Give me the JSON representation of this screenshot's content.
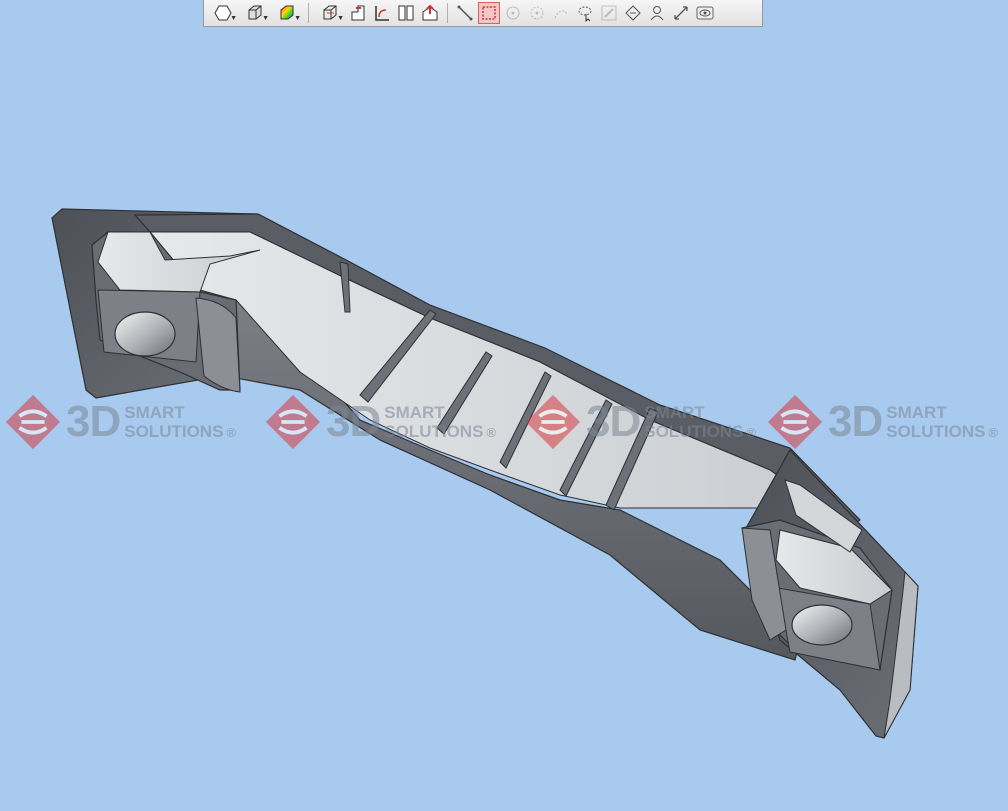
{
  "colors": {
    "viewport_background": "#a7caee",
    "part_dark": "#5b5e64",
    "part_mid": "#8a8d92",
    "part_light": "#d9dbde",
    "watermark_red": "#d63c40",
    "watermark_gray": "#7b8796"
  },
  "toolbar": {
    "buttons": [
      {
        "icon": "view-orientation-icon",
        "dropdown": true
      },
      {
        "icon": "display-style-icon",
        "dropdown": true
      },
      {
        "icon": "appearance-icon",
        "dropdown": true
      },
      {
        "icon": "section-view-icon",
        "dropdown": true
      },
      {
        "icon": "rotate-view-icon"
      },
      {
        "icon": "pan-view-icon"
      },
      {
        "icon": "split-view-icon"
      },
      {
        "icon": "render-tools-icon"
      },
      {
        "icon": "sketch-line-icon"
      },
      {
        "icon": "box-select-icon",
        "active": true
      },
      {
        "icon": "point-icon",
        "disabled": true
      },
      {
        "icon": "circle-icon",
        "disabled": true
      },
      {
        "icon": "arc-icon",
        "disabled": true
      },
      {
        "icon": "lasso-select-icon"
      },
      {
        "icon": "edit-sketch-icon",
        "disabled": true
      },
      {
        "icon": "display-delete-icon"
      },
      {
        "icon": "walk-through-icon"
      },
      {
        "icon": "measure-icon"
      },
      {
        "icon": "hide-show-icon"
      }
    ]
  },
  "watermark": {
    "big_text": "3D",
    "line1": "SMART",
    "line2": "SOLUTIONS",
    "mark": "®"
  }
}
